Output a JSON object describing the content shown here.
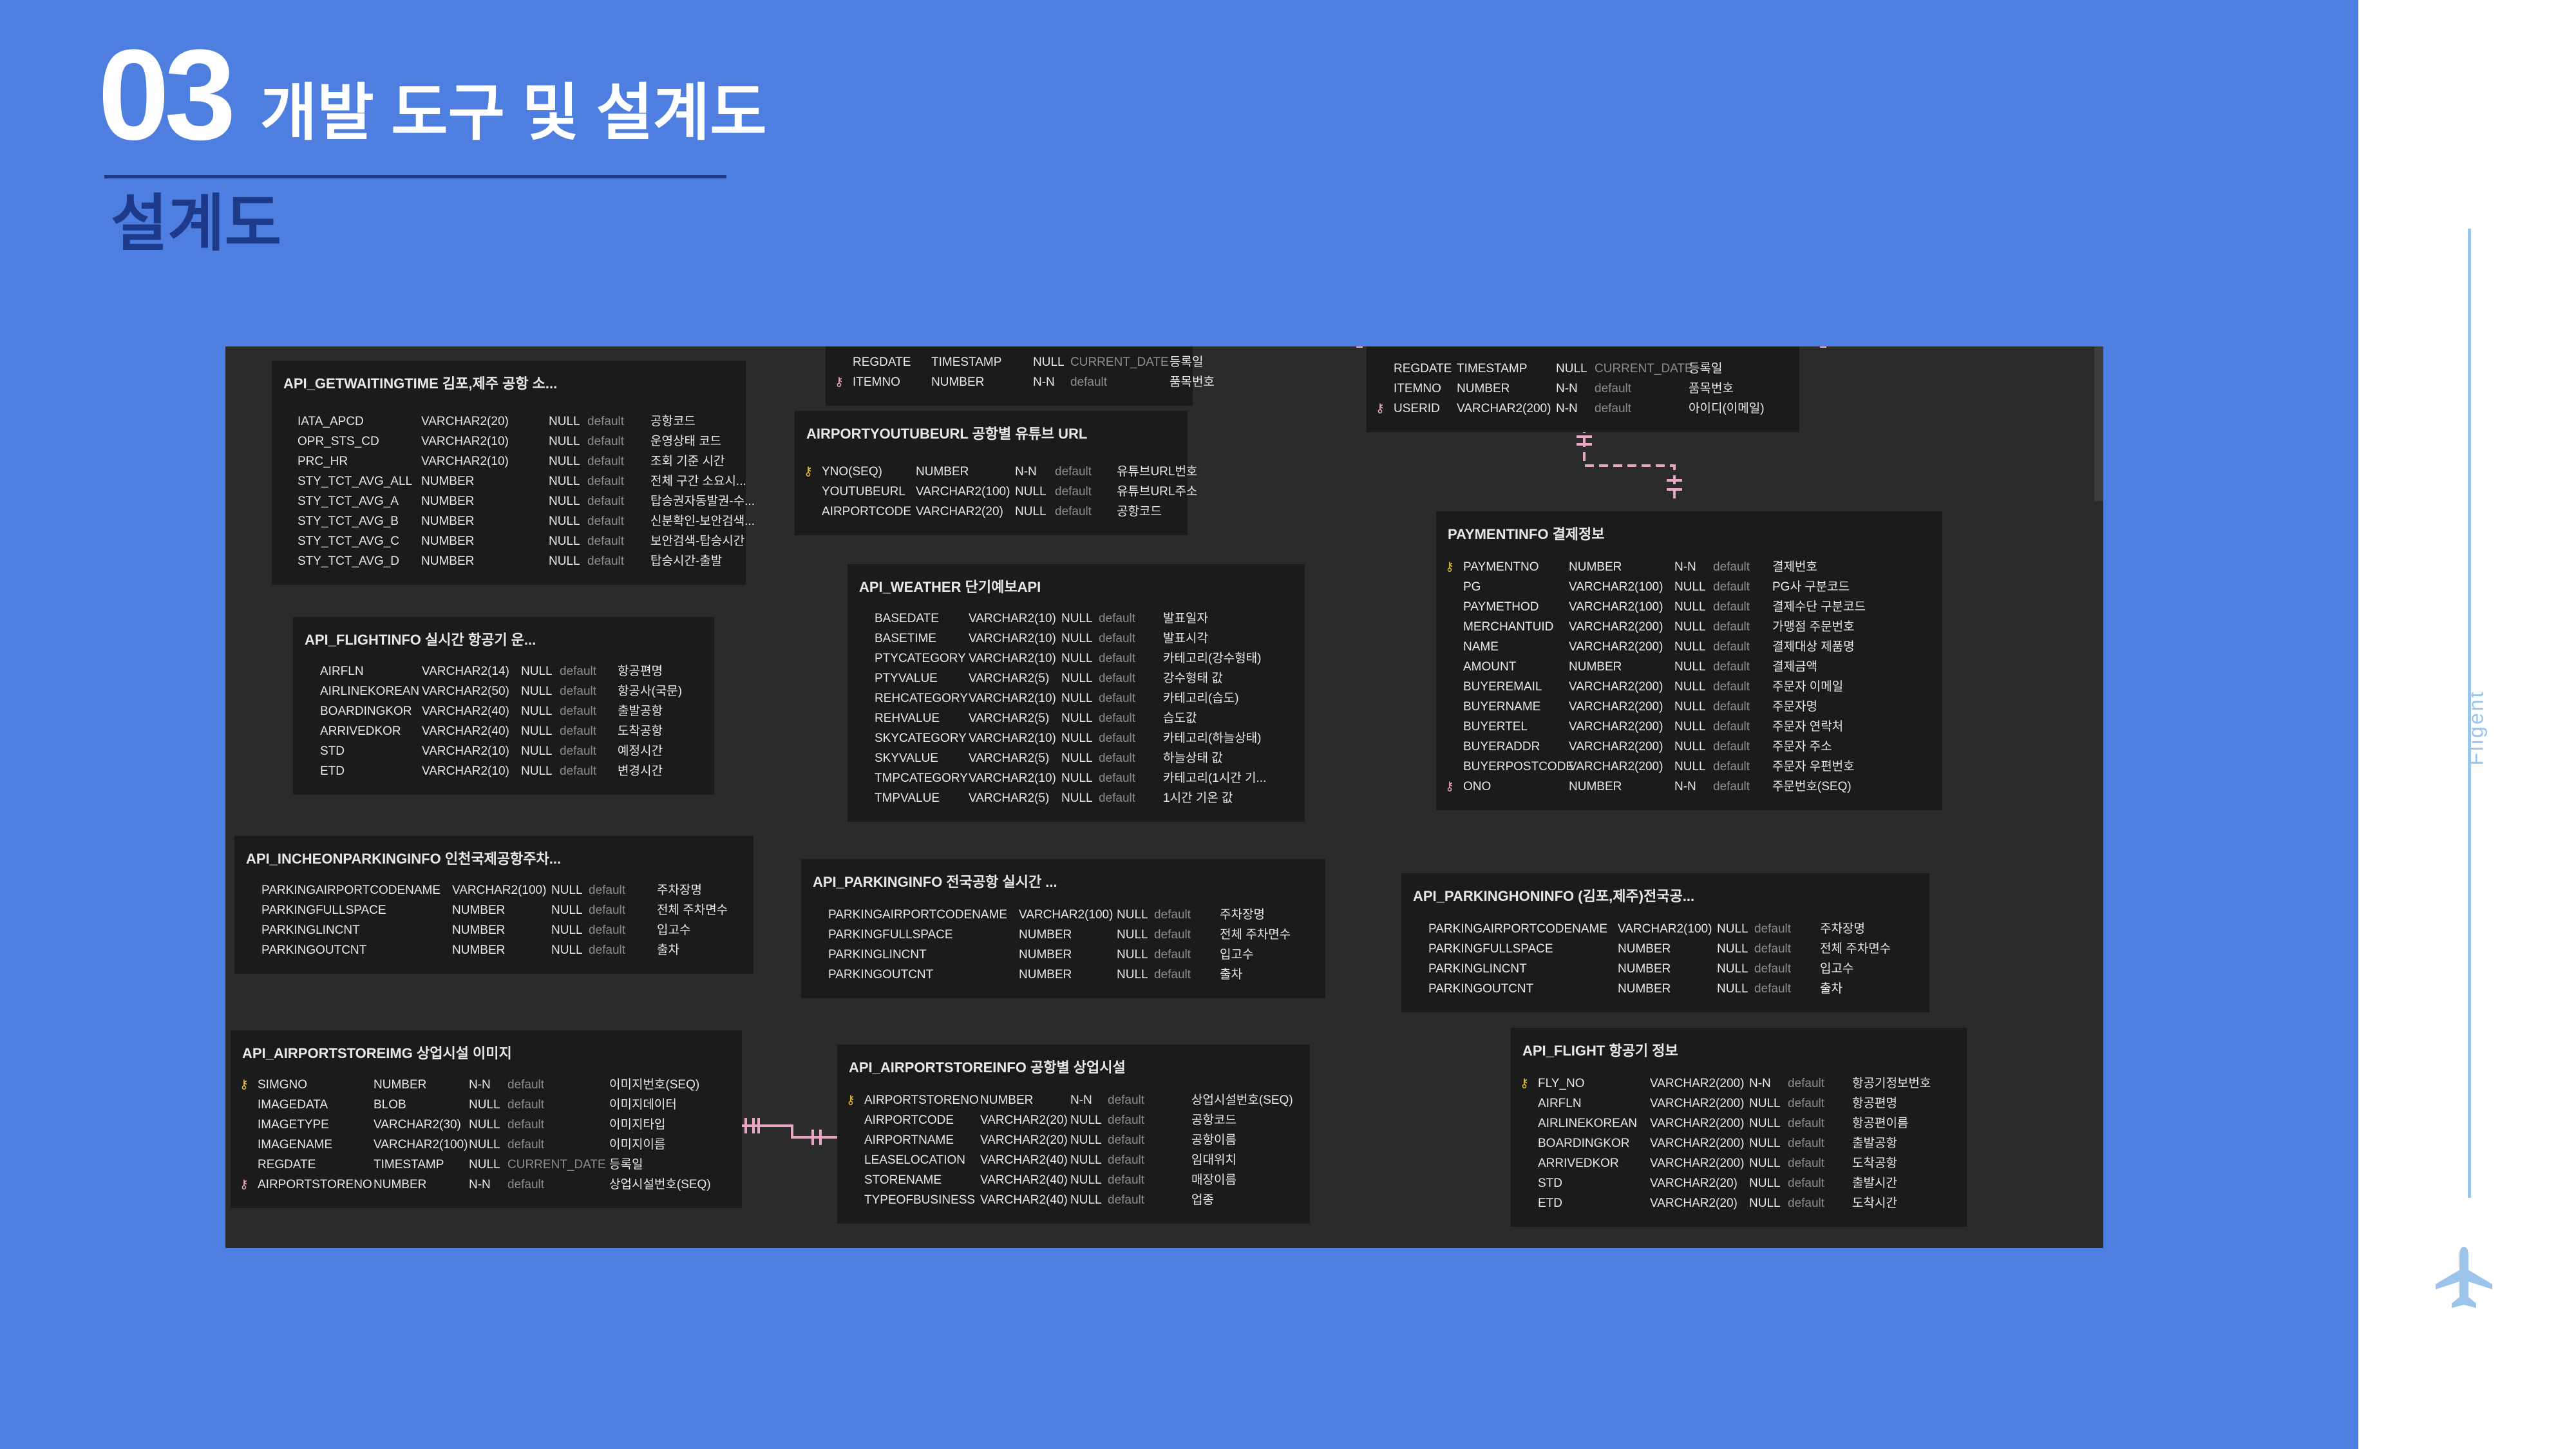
{
  "page": {
    "number": "03",
    "title": "개발 도구 및 설계도",
    "subtitle": "설계도",
    "brand": "Fligent"
  },
  "colors": {
    "background": "#4e7fe0",
    "title_dark": "#1d3b8a",
    "side_line": "#9cc3ea",
    "erd_bg": "#2b2b2b",
    "table_bg": "#1b1b1b",
    "relation": "#e8a6c4",
    "pk_key": "#e8c43a",
    "fk_key": "#f2a8c8"
  },
  "icons": {
    "plane": "airplane-icon",
    "primary_key": "key-icon"
  },
  "tables": [
    {
      "name": "API_GETWAITINGTIME 김포,제주 공항 소...",
      "rows": [
        {
          "col": "IATA_APCD",
          "type": "VARCHAR2(20)",
          "null": "NULL",
          "def": "default",
          "comment": "공항코드"
        },
        {
          "col": "OPR_STS_CD",
          "type": "VARCHAR2(10)",
          "null": "NULL",
          "def": "default",
          "comment": "운영상태 코드"
        },
        {
          "col": "PRC_HR",
          "type": "VARCHAR2(10)",
          "null": "NULL",
          "def": "default",
          "comment": "조회 기준 시간"
        },
        {
          "col": "STY_TCT_AVG_ALL",
          "type": "NUMBER",
          "null": "NULL",
          "def": "default",
          "comment": "전체 구간 소요시..."
        },
        {
          "col": "STY_TCT_AVG_A",
          "type": "NUMBER",
          "null": "NULL",
          "def": "default",
          "comment": "탑승권자동발권-수..."
        },
        {
          "col": "STY_TCT_AVG_B",
          "type": "NUMBER",
          "null": "NULL",
          "def": "default",
          "comment": "신분확인-보안검색..."
        },
        {
          "col": "STY_TCT_AVG_C",
          "type": "NUMBER",
          "null": "NULL",
          "def": "default",
          "comment": "보안검색-탑승시간"
        },
        {
          "col": "STY_TCT_AVG_D",
          "type": "NUMBER",
          "null": "NULL",
          "def": "default",
          "comment": "탑승시간-출발"
        }
      ]
    },
    {
      "name": "",
      "rows": [
        {
          "col": "REGDATE",
          "type": "TIMESTAMP",
          "null": "NULL",
          "def": "CURRENT_DATE",
          "comment": "등록일"
        },
        {
          "col": "ITEMNO",
          "type": "NUMBER",
          "null": "N-N",
          "def": "default",
          "comment": "품목번호",
          "key": "fk"
        }
      ]
    },
    {
      "name": "AIRPORTYOUTUBEURL 공항별 유튜브 URL",
      "rows": [
        {
          "col": "YNO(SEQ)",
          "type": "NUMBER",
          "null": "N-N",
          "def": "default",
          "comment": "유튜브URL번호",
          "key": "pk"
        },
        {
          "col": "YOUTUBEURL",
          "type": "VARCHAR2(100)",
          "null": "NULL",
          "def": "default",
          "comment": "유튜브URL주소"
        },
        {
          "col": "AIRPORTCODE",
          "type": "VARCHAR2(20)",
          "null": "NULL",
          "def": "default",
          "comment": "공항코드"
        }
      ]
    },
    {
      "name": "",
      "rows": [
        {
          "col": "REGDATE",
          "type": "TIMESTAMP",
          "null": "NULL",
          "def": "CURRENT_DATE",
          "comment": "등록일"
        },
        {
          "col": "ITEMNO",
          "type": "NUMBER",
          "null": "N-N",
          "def": "default",
          "comment": "품목번호"
        },
        {
          "col": "USERID",
          "type": "VARCHAR2(200)",
          "null": "N-N",
          "def": "default",
          "comment": "아이디(이메일)",
          "key": "fk"
        }
      ]
    },
    {
      "name": "API_FLIGHTINFO 실시간 항공기 운...",
      "rows": [
        {
          "col": "AIRFLN",
          "type": "VARCHAR2(14)",
          "null": "NULL",
          "def": "default",
          "comment": "항공편명"
        },
        {
          "col": "AIRLINEKOREAN",
          "type": "VARCHAR2(50)",
          "null": "NULL",
          "def": "default",
          "comment": "항공사(국문)"
        },
        {
          "col": "BOARDINGKOR",
          "type": "VARCHAR2(40)",
          "null": "NULL",
          "def": "default",
          "comment": "출발공항"
        },
        {
          "col": "ARRIVEDKOR",
          "type": "VARCHAR2(40)",
          "null": "NULL",
          "def": "default",
          "comment": "도착공항"
        },
        {
          "col": "STD",
          "type": "VARCHAR2(10)",
          "null": "NULL",
          "def": "default",
          "comment": "예정시간"
        },
        {
          "col": "ETD",
          "type": "VARCHAR2(10)",
          "null": "NULL",
          "def": "default",
          "comment": "변경시간"
        }
      ]
    },
    {
      "name": "API_WEATHER 단기예보API",
      "rows": [
        {
          "col": "BASEDATE",
          "type": "VARCHAR2(10)",
          "null": "NULL",
          "def": "default",
          "comment": "발표일자"
        },
        {
          "col": "BASETIME",
          "type": "VARCHAR2(10)",
          "null": "NULL",
          "def": "default",
          "comment": "발표시각"
        },
        {
          "col": "PTYCATEGORY",
          "type": "VARCHAR2(10)",
          "null": "NULL",
          "def": "default",
          "comment": "카테고리(강수형태)"
        },
        {
          "col": "PTYVALUE",
          "type": "VARCHAR2(5)",
          "null": "NULL",
          "def": "default",
          "comment": "강수형태 값"
        },
        {
          "col": "REHCATEGORY",
          "type": "VARCHAR2(10)",
          "null": "NULL",
          "def": "default",
          "comment": "카테고리(습도)"
        },
        {
          "col": "REHVALUE",
          "type": "VARCHAR2(5)",
          "null": "NULL",
          "def": "default",
          "comment": "습도값"
        },
        {
          "col": "SKYCATEGORY",
          "type": "VARCHAR2(10)",
          "null": "NULL",
          "def": "default",
          "comment": "카테고리(하늘상태)"
        },
        {
          "col": "SKYVALUE",
          "type": "VARCHAR2(5)",
          "null": "NULL",
          "def": "default",
          "comment": "하늘상태 값"
        },
        {
          "col": "TMPCATEGORY",
          "type": "VARCHAR2(10)",
          "null": "NULL",
          "def": "default",
          "comment": "카테고리(1시간 기..."
        },
        {
          "col": "TMPVALUE",
          "type": "VARCHAR2(5)",
          "null": "NULL",
          "def": "default",
          "comment": "1시간 기온 값"
        }
      ]
    },
    {
      "name": "PAYMENTINFO 결제정보",
      "rows": [
        {
          "col": "PAYMENTNO",
          "type": "NUMBER",
          "null": "N-N",
          "def": "default",
          "comment": "결제번호",
          "key": "pk"
        },
        {
          "col": "PG",
          "type": "VARCHAR2(100)",
          "null": "NULL",
          "def": "default",
          "comment": "PG사 구분코드"
        },
        {
          "col": "PAYMETHOD",
          "type": "VARCHAR2(100)",
          "null": "NULL",
          "def": "default",
          "comment": "결제수단 구분코드"
        },
        {
          "col": "MERCHANTUID",
          "type": "VARCHAR2(200)",
          "null": "NULL",
          "def": "default",
          "comment": "가맹점 주문번호"
        },
        {
          "col": "NAME",
          "type": "VARCHAR2(200)",
          "null": "NULL",
          "def": "default",
          "comment": "결제대상 제품명"
        },
        {
          "col": "AMOUNT",
          "type": "NUMBER",
          "null": "NULL",
          "def": "default",
          "comment": "결제금액"
        },
        {
          "col": "BUYEREMAIL",
          "type": "VARCHAR2(200)",
          "null": "NULL",
          "def": "default",
          "comment": "주문자 이메일"
        },
        {
          "col": "BUYERNAME",
          "type": "VARCHAR2(200)",
          "null": "NULL",
          "def": "default",
          "comment": "주문자명"
        },
        {
          "col": "BUYERTEL",
          "type": "VARCHAR2(200)",
          "null": "NULL",
          "def": "default",
          "comment": "주문자 연락처"
        },
        {
          "col": "BUYERADDR",
          "type": "VARCHAR2(200)",
          "null": "NULL",
          "def": "default",
          "comment": "주문자 주소"
        },
        {
          "col": "BUYERPOSTCODE",
          "type": "VARCHAR2(200)",
          "null": "NULL",
          "def": "default",
          "comment": "주문자 우편번호"
        },
        {
          "col": "ONO",
          "type": "NUMBER",
          "null": "N-N",
          "def": "default",
          "comment": "주문번호(SEQ)",
          "key": "fk"
        }
      ]
    },
    {
      "name": "API_INCHEONPARKINGINFO 인천국제공항주차...",
      "rows": [
        {
          "col": "PARKINGAIRPORTCODENAME",
          "type": "VARCHAR2(100)",
          "null": "NULL",
          "def": "default",
          "comment": "주차장명"
        },
        {
          "col": "PARKINGFULLSPACE",
          "type": "NUMBER",
          "null": "NULL",
          "def": "default",
          "comment": "전체 주차면수"
        },
        {
          "col": "PARKINGLINCNT",
          "type": "NUMBER",
          "null": "NULL",
          "def": "default",
          "comment": "입고수"
        },
        {
          "col": "PARKINGOUTCNT",
          "type": "NUMBER",
          "null": "NULL",
          "def": "default",
          "comment": "출차"
        }
      ]
    },
    {
      "name": "API_PARKINGINFO 전국공항 실시간 ...",
      "rows": [
        {
          "col": "PARKINGAIRPORTCODENAME",
          "type": "VARCHAR2(100)",
          "null": "NULL",
          "def": "default",
          "comment": "주차장명"
        },
        {
          "col": "PARKINGFULLSPACE",
          "type": "NUMBER",
          "null": "NULL",
          "def": "default",
          "comment": "전체 주차면수"
        },
        {
          "col": "PARKINGLINCNT",
          "type": "NUMBER",
          "null": "NULL",
          "def": "default",
          "comment": "입고수"
        },
        {
          "col": "PARKINGOUTCNT",
          "type": "NUMBER",
          "null": "NULL",
          "def": "default",
          "comment": "출차"
        }
      ]
    },
    {
      "name": "API_PARKINGHONINFO (김포,제주)전국공...",
      "rows": [
        {
          "col": "PARKINGAIRPORTCODENAME",
          "type": "VARCHAR2(100)",
          "null": "NULL",
          "def": "default",
          "comment": "주차장명"
        },
        {
          "col": "PARKINGFULLSPACE",
          "type": "NUMBER",
          "null": "NULL",
          "def": "default",
          "comment": "전체 주차면수"
        },
        {
          "col": "PARKINGLINCNT",
          "type": "NUMBER",
          "null": "NULL",
          "def": "default",
          "comment": "입고수"
        },
        {
          "col": "PARKINGOUTCNT",
          "type": "NUMBER",
          "null": "NULL",
          "def": "default",
          "comment": "출차"
        }
      ]
    },
    {
      "name": "API_AIRPORTSTOREIMG 상업시설 이미지",
      "rows": [
        {
          "col": "SIMGNO",
          "type": "NUMBER",
          "null": "N-N",
          "def": "default",
          "comment": "이미지번호(SEQ)",
          "key": "pk"
        },
        {
          "col": "IMAGEDATA",
          "type": "BLOB",
          "null": "NULL",
          "def": "default",
          "comment": "이미지데이터"
        },
        {
          "col": "IMAGETYPE",
          "type": "VARCHAR2(30)",
          "null": "NULL",
          "def": "default",
          "comment": "이미지타입"
        },
        {
          "col": "IMAGENAME",
          "type": "VARCHAR2(100)",
          "null": "NULL",
          "def": "default",
          "comment": "이미지이름"
        },
        {
          "col": "REGDATE",
          "type": "TIMESTAMP",
          "null": "NULL",
          "def": "CURRENT_DATE",
          "comment": "등록일"
        },
        {
          "col": "AIRPORTSTORENO",
          "type": "NUMBER",
          "null": "N-N",
          "def": "default",
          "comment": "상업시설번호(SEQ)",
          "key": "fk"
        }
      ]
    },
    {
      "name": "API_AIRPORTSTOREINFO 공항별 상업시설",
      "rows": [
        {
          "col": "AIRPORTSTORENO",
          "type": "NUMBER",
          "null": "N-N",
          "def": "default",
          "comment": "상업시설번호(SEQ)",
          "key": "pk"
        },
        {
          "col": "AIRPORTCODE",
          "type": "VARCHAR2(20)",
          "null": "NULL",
          "def": "default",
          "comment": "공항코드"
        },
        {
          "col": "AIRPORTNAME",
          "type": "VARCHAR2(20)",
          "null": "NULL",
          "def": "default",
          "comment": "공항이름"
        },
        {
          "col": "LEASELOCATION",
          "type": "VARCHAR2(40)",
          "null": "NULL",
          "def": "default",
          "comment": "임대위치"
        },
        {
          "col": "STORENAME",
          "type": "VARCHAR2(40)",
          "null": "NULL",
          "def": "default",
          "comment": "매장이름"
        },
        {
          "col": "TYPEOFBUSINESS",
          "type": "VARCHAR2(40)",
          "null": "NULL",
          "def": "default",
          "comment": "업종"
        }
      ]
    },
    {
      "name": "API_FLIGHT 항공기 정보",
      "rows": [
        {
          "col": "FLY_NO",
          "type": "VARCHAR2(200)",
          "null": "N-N",
          "def": "default",
          "comment": "항공기정보번호",
          "key": "pk"
        },
        {
          "col": "AIRFLN",
          "type": "VARCHAR2(200)",
          "null": "NULL",
          "def": "default",
          "comment": "항공편명"
        },
        {
          "col": "AIRLINEKOREAN",
          "type": "VARCHAR2(200)",
          "null": "NULL",
          "def": "default",
          "comment": "항공편이름"
        },
        {
          "col": "BOARDINGKOR",
          "type": "VARCHAR2(200)",
          "null": "NULL",
          "def": "default",
          "comment": "출발공항"
        },
        {
          "col": "ARRIVEDKOR",
          "type": "VARCHAR2(200)",
          "null": "NULL",
          "def": "default",
          "comment": "도착공항"
        },
        {
          "col": "STD",
          "type": "VARCHAR2(20)",
          "null": "NULL",
          "def": "default",
          "comment": "출발시간"
        },
        {
          "col": "ETD",
          "type": "VARCHAR2(20)",
          "null": "NULL",
          "def": "default",
          "comment": "도착시간"
        }
      ]
    }
  ]
}
